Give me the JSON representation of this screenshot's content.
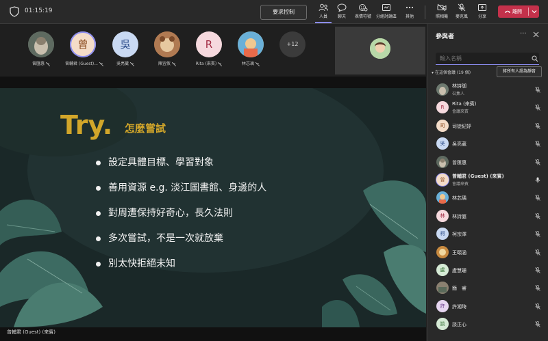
{
  "topbar": {
    "timer": "01:15:19",
    "request_control_label": "要求控制",
    "buttons": [
      {
        "label": "人員",
        "icon": "people-icon"
      },
      {
        "label": "聊天",
        "icon": "chat-icon"
      },
      {
        "label": "表情符號",
        "icon": "reactions-icon"
      },
      {
        "label": "分組討論區",
        "icon": "breakout-rooms-icon"
      },
      {
        "label": "其他",
        "icon": "more-icon"
      },
      {
        "label": "照相機",
        "icon": "camera-off-icon"
      },
      {
        "label": "麥克風",
        "icon": "mic-off-icon"
      },
      {
        "label": "分享",
        "icon": "share-icon"
      }
    ],
    "leave_label": "離開"
  },
  "strip": {
    "participants": [
      {
        "name": "曾匯惠",
        "avatar": "",
        "color": "#6e7a70"
      },
      {
        "name": "曾輔君 (Guest)...",
        "avatar": "曾",
        "color": "#f4dcc8",
        "fg": "#8a4a1e"
      },
      {
        "name": "吳亮葳",
        "avatar": "吳",
        "color": "#c9d9f2",
        "fg": "#2a4a88"
      },
      {
        "name": "陳宜攸",
        "avatar": "",
        "color": "#9b6a4a"
      },
      {
        "name": "Rita (來賓)",
        "avatar": "R",
        "color": "#f6d9de",
        "fg": "#a12a42"
      },
      {
        "name": "林芯瑀",
        "avatar": "",
        "color": "#e8b850"
      }
    ],
    "more_count": "+12"
  },
  "slide": {
    "title": "Try.",
    "subtitle": "怎麼嘗試",
    "bullets": [
      "設定具體目標、學習對象",
      "善用資源 e.g. 淡江圖書館、身邊的人",
      "對周遭保持好奇心，長久法則",
      "多次嘗試，不是一次就放棄",
      "別太快拒絕未知"
    ]
  },
  "presenter_caption": "曾輔君 (Guest) (來賓)",
  "panel": {
    "title": "參與者",
    "search_placeholder": "輸入名稱",
    "section_label": "在這個會議 (19 個)",
    "mute_all_label": "將所有人設為靜音",
    "people": [
      {
        "name": "林詩珈",
        "role": "召集人",
        "avatar": "",
        "color": "#7a8a7a",
        "mic": "muted"
      },
      {
        "name": "Rita (來賓)",
        "role": "會議來賓",
        "avatar": "R",
        "color": "#f6d9de",
        "fg": "#a12a42",
        "mic": "muted"
      },
      {
        "name": "司徒紀妤",
        "role": "",
        "avatar": "司",
        "color": "#f4dcc8",
        "fg": "#8a4a1e",
        "mic": "muted"
      },
      {
        "name": "吳亮葳",
        "role": "",
        "avatar": "吳",
        "color": "#c9d9f2",
        "fg": "#2a4a88",
        "mic": "muted"
      },
      {
        "name": "曾匯惠",
        "role": "",
        "avatar": "",
        "color": "#6e7a70",
        "mic": "muted"
      },
      {
        "name": "曾輔君 (Guest) (來賓)",
        "role": "會議來賓",
        "avatar": "曾",
        "color": "#f4dcc8",
        "fg": "#8a4a1e",
        "mic": "on"
      },
      {
        "name": "林芯瑀",
        "role": "",
        "avatar": "",
        "color": "#e8b850",
        "mic": "muted"
      },
      {
        "name": "林詩庭",
        "role": "",
        "avatar": "林",
        "color": "#f6d9de",
        "fg": "#a12a42",
        "mic": "muted"
      },
      {
        "name": "柯宗澤",
        "role": "",
        "avatar": "柯",
        "color": "#c9d9f2",
        "fg": "#2a4a88",
        "mic": "muted"
      },
      {
        "name": "王頤涵",
        "role": "",
        "avatar": "",
        "color": "#c88a40",
        "mic": "muted"
      },
      {
        "name": "盧慧珊",
        "role": "",
        "avatar": "盧",
        "color": "#d5ead5",
        "fg": "#2a6a2a",
        "mic": "muted"
      },
      {
        "name": "簡　睿",
        "role": "",
        "avatar": "",
        "color": "#8a8070",
        "mic": "muted"
      },
      {
        "name": "許湘琦",
        "role": "",
        "avatar": "許",
        "color": "#e6d5f0",
        "fg": "#6a3a8a",
        "mic": "muted"
      },
      {
        "name": "談正心",
        "role": "",
        "avatar": "談",
        "color": "#d5ead5",
        "fg": "#2a6a2a",
        "mic": "muted"
      },
      {
        "name": "",
        "role": "",
        "avatar": "",
        "color": "#7a8a7a",
        "mic": "muted"
      }
    ]
  }
}
